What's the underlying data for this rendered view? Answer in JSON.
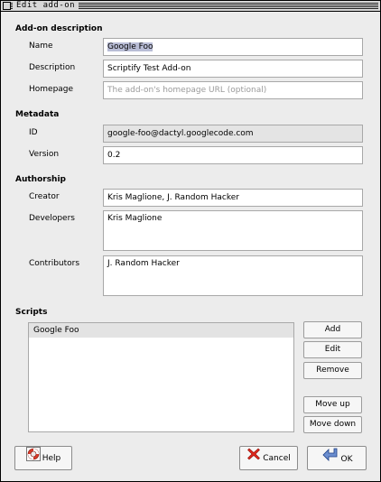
{
  "window": {
    "title": "Edit add-on"
  },
  "sections": {
    "description": "Add-on description",
    "metadata": "Metadata",
    "authorship": "Authorship",
    "scripts": "Scripts"
  },
  "fields": {
    "name": {
      "label": "Name",
      "value": "Google Foo"
    },
    "description": {
      "label": "Description",
      "value": "Scriptify Test Add-on"
    },
    "homepage": {
      "label": "Homepage",
      "value": "",
      "placeholder": "The add-on's homepage URL (optional)"
    },
    "id": {
      "label": "ID",
      "value": "google-foo@dactyl.googlecode.com"
    },
    "version": {
      "label": "Version",
      "value": "0.2"
    },
    "creator": {
      "label": "Creator",
      "value": "Kris Maglione, J. Random Hacker"
    },
    "developers": {
      "label": "Developers",
      "value": "Kris Maglione"
    },
    "contributors": {
      "label": "Contributors",
      "value": "J. Random Hacker"
    }
  },
  "scripts": {
    "items": [
      "Google Foo"
    ]
  },
  "buttons": {
    "add": "Add",
    "edit": "Edit",
    "remove": "Remove",
    "move_up": "Move up",
    "move_down": "Move down",
    "help": "Help",
    "cancel": "Cancel",
    "ok": "OK"
  },
  "colors": {
    "selection": "#b9bdd6",
    "readonly": "#e4e4e4",
    "window": "#ececec"
  },
  "icons": {
    "help": "lifebuoy-icon",
    "cancel": "red-x-icon",
    "ok": "enter-arrow-icon",
    "close": "close-box-icon"
  }
}
